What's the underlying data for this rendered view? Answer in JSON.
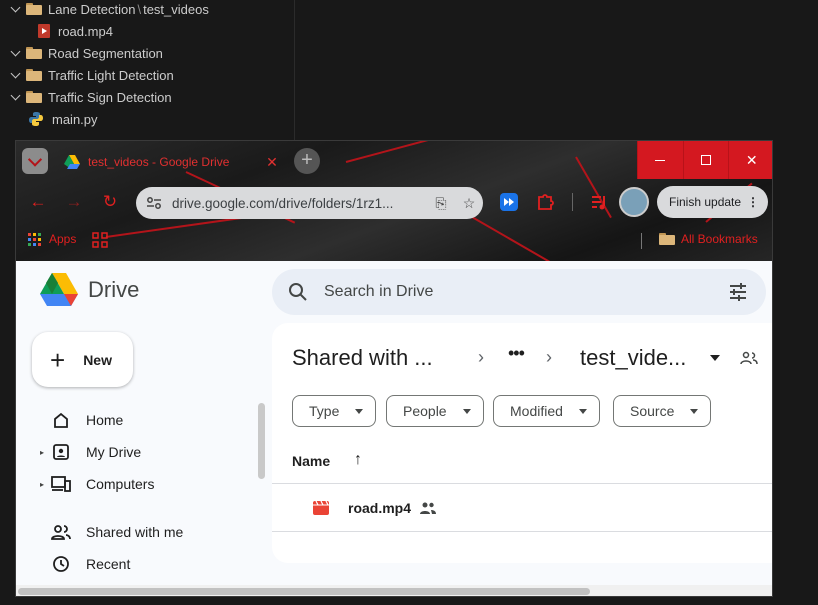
{
  "explorer": {
    "items": [
      {
        "label": "Lane Detection",
        "sub": "test_videos",
        "type": "folder"
      },
      {
        "label": "road.mp4",
        "type": "mp4"
      },
      {
        "label": "Road Segmentation",
        "type": "folder"
      },
      {
        "label": "Traffic Light Detection",
        "type": "folder"
      },
      {
        "label": "Traffic Sign Detection",
        "type": "folder"
      },
      {
        "label": "main.py",
        "type": "python"
      }
    ],
    "path_sep": "\\"
  },
  "browser": {
    "tab_title": "test_videos - Google Drive",
    "tab_close": "✕",
    "new_tab": "+",
    "url": "drive.google.com/drive/folders/1rz1...",
    "update_label": "Finish update",
    "bookmarks": {
      "apps": "Apps",
      "all": "All Bookmarks"
    },
    "theme_accent": "#d41820"
  },
  "drive": {
    "app_name": "Drive",
    "search_placeholder": "Search in Drive",
    "new_label": "New",
    "nav": [
      {
        "label": "Home",
        "icon": "home-icon"
      },
      {
        "label": "My Drive",
        "icon": "my-drive-icon"
      },
      {
        "label": "Computers",
        "icon": "computers-icon"
      },
      {
        "label": "Shared with me",
        "icon": "shared-icon"
      },
      {
        "label": "Recent",
        "icon": "clock-icon"
      }
    ],
    "breadcrumb": {
      "root": "Shared with ...",
      "ellipsis": "•••",
      "current": "test_vide..."
    },
    "filters": [
      "Type",
      "People",
      "Modified",
      "Source"
    ],
    "column_name": "Name",
    "files": [
      {
        "name": "road.mp4",
        "shared": true
      }
    ]
  }
}
